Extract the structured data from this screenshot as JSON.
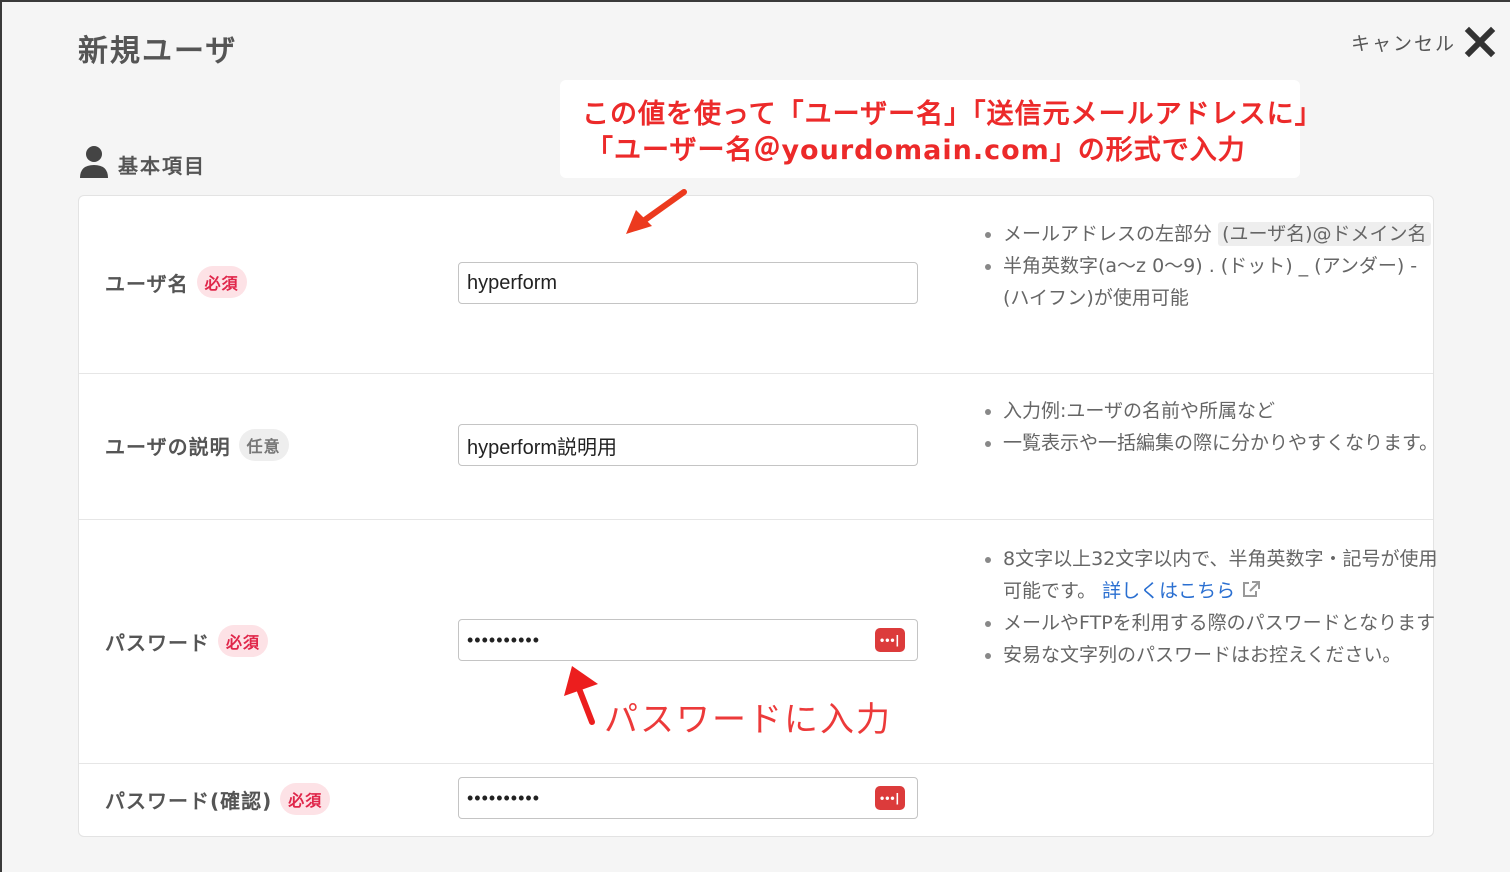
{
  "header": {
    "title": "新規ユーザ",
    "cancel_label": "キャンセル"
  },
  "annotation": {
    "line1": "この値を使って「ユーザー名」「送信元メールアドレスに」",
    "line2": "「ユーザー名＠yourdomain.com」の形式で入力",
    "password_note": "パスワードに入力"
  },
  "section": {
    "title": "基本項目"
  },
  "fields": {
    "username": {
      "label": "ユーザ名",
      "badge": "必須",
      "value": "hyperform",
      "help1_pre": "メールアドレスの左部分",
      "help1_code": "(ユーザ名)@ドメイン名",
      "help2": "半角英数字(a〜z 0〜9) . (ドット) _ (アンダー) - (ハイフン)が使用可能"
    },
    "description": {
      "label": "ユーザの説明",
      "badge": "任意",
      "value": "hyperform説明用",
      "help1": "入力例:ユーザの名前や所属など",
      "help2": "一覧表示や一括編集の際に分かりやすくなります。"
    },
    "password": {
      "label": "パスワード",
      "badge": "必須",
      "value": "••••••••••",
      "icon_text": "•••|",
      "help1_pre": "8文字以上32文字以内で、半角英数字・記号が使用可能です。",
      "help1_link": "詳しくはこちら",
      "help2": "メールやFTPを利用する際のパスワードとなります",
      "help3": "安易な文字列のパスワードはお控えください。"
    },
    "password_confirm": {
      "label": "パスワード(確認)",
      "badge": "必須",
      "value": "••••••••••",
      "icon_text": "•••|"
    }
  },
  "colors": {
    "annotation": "#ec2a2a",
    "required_bg": "#fde2e6",
    "required_text": "#e0264a",
    "link": "#2a6fd1",
    "pw_icon": "#dc3b3b"
  }
}
